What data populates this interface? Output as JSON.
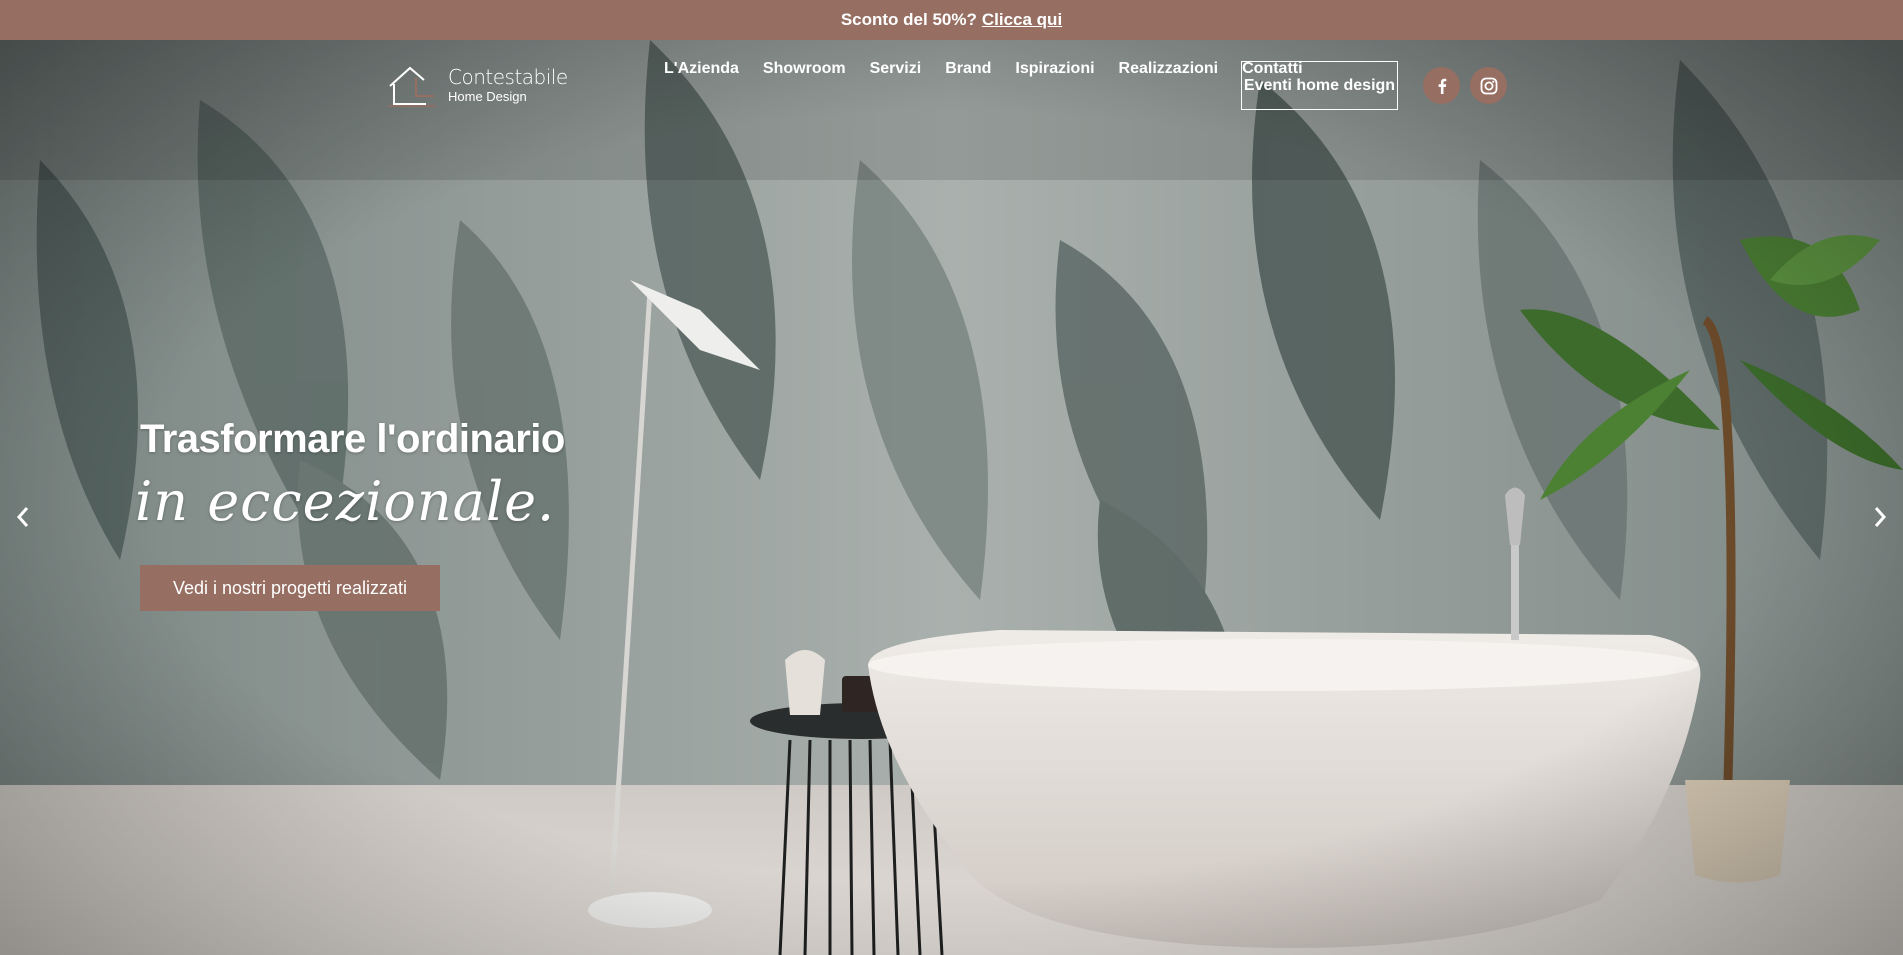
{
  "promo": {
    "text": "Sconto del 50%?",
    "link_label": "Clicca qui"
  },
  "logo": {
    "name": "Contestabile",
    "tagline": "Home Design"
  },
  "nav": {
    "items": [
      {
        "label": "L'Azienda"
      },
      {
        "label": "Showroom"
      },
      {
        "label": "Servizi"
      },
      {
        "label": "Brand"
      },
      {
        "label": "Ispirazioni"
      },
      {
        "label": "Realizzazioni"
      },
      {
        "label": "Contatti"
      }
    ],
    "event_button": "Eventi home design"
  },
  "social": {
    "facebook_icon": "facebook-icon",
    "instagram_icon": "instagram-icon"
  },
  "hero": {
    "headline": "Trasformare l'ordinario",
    "script": "in eccezionale.",
    "cta_label": "Vedi i nostri progetti realizzati",
    "prev_icon": "chevron-left-icon",
    "next_icon": "chevron-right-icon"
  },
  "colors": {
    "accent": "#966e62",
    "text": "#ffffff"
  }
}
